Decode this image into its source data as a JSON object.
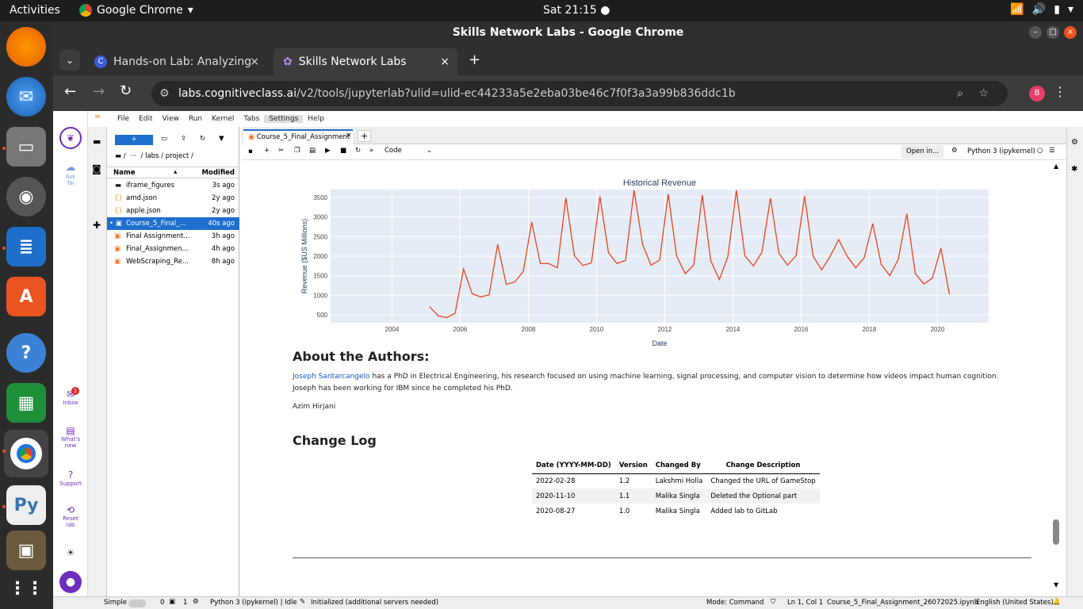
{
  "topbar": {
    "activities": "Activities",
    "app_name": "Google Chrome",
    "clock": "Sat 21:15"
  },
  "chrome": {
    "window_title": "Skills Network Labs - Google Chrome",
    "tabs": [
      {
        "label": "Hands-on Lab: Analyzing"
      },
      {
        "label": "Skills Network Labs"
      }
    ],
    "url_host": "labs.cognitiveclass.ai",
    "url_path": "/v2/tools/jupyterlab?ulid=ulid-ec44233a5e2eba03be46c7f0f3a3a99b836ddc1b",
    "profile_initial": "B"
  },
  "menu": [
    "File",
    "Edit",
    "View",
    "Run",
    "Kernel",
    "Tabs",
    "Settings",
    "Help"
  ],
  "sn_sidebar": {
    "ask": "Ask",
    "tai": "Tai",
    "inbox": "Inbox",
    "inbox_badge": "1",
    "whats": "What's",
    "new": "new",
    "support": "Support",
    "reset": "Reset",
    "lab": "lab"
  },
  "filebrowser": {
    "breadcrumb": "/  ···  / labs / project /",
    "col_name": "Name",
    "col_modified": "Modified",
    "files": [
      {
        "name": "iframe_figures",
        "modified": "3s ago"
      },
      {
        "name": "amd.json",
        "modified": "2y ago"
      },
      {
        "name": "apple.json",
        "modified": "2y ago"
      },
      {
        "name": "Course_5_Final_...",
        "modified": "40s ago"
      },
      {
        "name": "Final Assignment...",
        "modified": "3h ago"
      },
      {
        "name": "Final_Assignmen...",
        "modified": "4h ago"
      },
      {
        "name": "WebScraping_Re...",
        "modified": "8h ago"
      }
    ]
  },
  "notebook": {
    "tab_label": "Course_5_Final_Assignment",
    "cell_type": "Code",
    "open_in": "Open in...",
    "kernel": "Python 3 (ipykernel)",
    "about_title": "About the Authors:",
    "author_link": "Joseph Santarcangelo",
    "author_text": " has a PhD in Electrical Engineering, his research focused on using machine learning, signal processing, and computer vision to determine how videos impact human cognition. Joseph has been working for IBM since he completed his PhD.",
    "author2": "Azim Hirjani",
    "changelog_title": "Change Log",
    "changelog_headers": [
      "Date (YYYY-MM-DD)",
      "Version",
      "Changed By",
      "Change Description"
    ],
    "changelog_rows": [
      [
        "2022-02-28",
        "1.2",
        "Lakshmi Holla",
        "Changed the URL of GameStop"
      ],
      [
        "2020-11-10",
        "1.1",
        "Malika Singla",
        "Deleted the Optional part"
      ],
      [
        "2020-08-27",
        "1.0",
        "Malika Singla",
        "Added lab to GitLab"
      ]
    ]
  },
  "chart_data": {
    "type": "line",
    "title": "Historical Revenue",
    "xlabel": "Date",
    "ylabel": "Revenue ($US Millions)",
    "xlim": [
      2002.2,
      2021.5
    ],
    "ylim": [
      300,
      3700
    ],
    "xticks": [
      2004,
      2006,
      2008,
      2010,
      2012,
      2014,
      2016,
      2018,
      2020
    ],
    "yticks": [
      500,
      1000,
      1500,
      2000,
      2500,
      3000,
      3500
    ],
    "colors": {
      "line": "#e8431e",
      "plot_bg": "#e5ecf6"
    },
    "series": [
      {
        "x": [
          2005.1,
          2005.35,
          2005.6,
          2005.85,
          2006.1,
          2006.35,
          2006.6,
          2006.85,
          2007.1,
          2007.35,
          2007.6,
          2007.85,
          2008.1,
          2008.35,
          2008.6,
          2008.85,
          2009.1,
          2009.35,
          2009.6,
          2009.85,
          2010.1,
          2010.35,
          2010.6,
          2010.85,
          2011.1,
          2011.35,
          2011.6,
          2011.85,
          2012.1,
          2012.35,
          2012.6,
          2012.85,
          2013.1,
          2013.35,
          2013.6,
          2013.85,
          2014.1,
          2014.35,
          2014.6,
          2014.85,
          2015.1,
          2015.35,
          2015.6,
          2015.85,
          2016.1,
          2016.35,
          2016.6,
          2016.85,
          2017.1,
          2017.35,
          2017.6,
          2017.85,
          2018.1,
          2018.35,
          2018.6,
          2018.85,
          2019.1,
          2019.35,
          2019.6,
          2019.85,
          2020.1,
          2020.35
        ],
        "y": [
          710,
          480,
          430,
          540,
          1670,
          1040,
          960,
          1010,
          2300,
          1280,
          1340,
          1610,
          2870,
          1810,
          1810,
          1700,
          3490,
          2010,
          1760,
          1830,
          3520,
          2090,
          1810,
          1890,
          3680,
          2300,
          1770,
          1900,
          3580,
          2000,
          1550,
          1780,
          3560,
          1880,
          1400,
          1980,
          3680,
          2010,
          1750,
          2100,
          3480,
          2070,
          1770,
          2010,
          3530,
          2000,
          1650,
          1990,
          2420,
          2000,
          1700,
          1960,
          2830,
          1790,
          1500,
          1920,
          3080,
          1550,
          1290,
          1440,
          2200,
          1020
        ]
      }
    ]
  },
  "statusbar": {
    "simple": "Simple",
    "num0": "0",
    "num1": "1",
    "kernel_status": "Python 3 (ipykernel) | Idle",
    "lsp": "Initialized (additional servers needed)",
    "mode": "Mode: Command",
    "cursor": "Ln 1, Col 1",
    "filename": "Course_5_Final_Assignment_26072025.ipynb",
    "locale": "English (United States)"
  }
}
